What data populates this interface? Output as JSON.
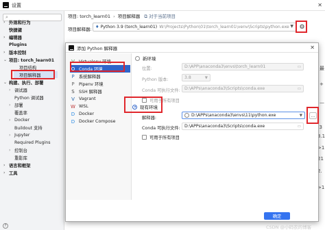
{
  "window": {
    "title": "设置"
  },
  "sidebar": {
    "items": [
      {
        "label": "外观和行为",
        "chev": "›",
        "bold": true
      },
      {
        "label": "快捷键",
        "chev": "",
        "bold": true
      },
      {
        "label": "编辑器",
        "chev": "›",
        "bold": true
      },
      {
        "label": "Plugins",
        "chev": "",
        "bold": true
      },
      {
        "label": "版本控制",
        "chev": "›",
        "bold": true
      },
      {
        "label": "项目: torch_learn01",
        "chev": "⌄",
        "bold": true
      },
      {
        "label": "项目结构",
        "chev": "",
        "bold": false
      },
      {
        "label": "项目解释器",
        "chev": "",
        "bold": false
      },
      {
        "label": "构建、执行、部署",
        "chev": "⌄",
        "bold": true
      },
      {
        "label": "调试器",
        "chev": "›",
        "bold": false
      },
      {
        "label": "Python 调试器",
        "chev": "",
        "bold": false
      },
      {
        "label": "部署",
        "chev": "›",
        "bold": false
      },
      {
        "label": "覆盖率",
        "chev": "",
        "bold": false
      },
      {
        "label": "Docker",
        "chev": "›",
        "bold": false
      },
      {
        "label": "Buildout 支持",
        "chev": "",
        "bold": false
      },
      {
        "label": "Jupyter",
        "chev": "›",
        "bold": false
      },
      {
        "label": "Required Plugins",
        "chev": "",
        "bold": false
      },
      {
        "label": "控制台",
        "chev": "›",
        "bold": false
      },
      {
        "label": "重影库",
        "chev": "",
        "bold": false
      },
      {
        "label": "语言和框架",
        "chev": "›",
        "bold": true
      },
      {
        "label": "工具",
        "chev": "›",
        "bold": true
      }
    ]
  },
  "breadcrumb": {
    "project": "项目: torch_learn01",
    "sep": "›",
    "page": "项目解释器",
    "scope": "对于当前项目"
  },
  "interpreter": {
    "label": "项目解释器:",
    "value": "Python 3.9 (torch_learn01)",
    "path": "W:\\Projects\\Python\\01\\torch_learn01\\venv\\Scripts\\python.exe"
  },
  "background_fragments": [
    "最",
    "+",
    "—",
    "-3",
    "3.1",
    ">1",
    "21",
    "2.",
    ">1"
  ],
  "dialog": {
    "title": "添加 Python 解释器",
    "env_types": [
      {
        "label": "Virtualenv 环境",
        "icon": "V"
      },
      {
        "label": "Conda 环境",
        "icon": "O"
      },
      {
        "label": "系统解释器",
        "icon": "P"
      },
      {
        "label": "Pipenv 环境",
        "icon": "P"
      },
      {
        "label": "SSH 解释器",
        "icon": "S"
      },
      {
        "label": "Vagrant",
        "icon": "V"
      },
      {
        "label": "WSL",
        "icon": "W"
      },
      {
        "label": "Docker",
        "icon": "D"
      },
      {
        "label": "Docker Compose",
        "icon": "D"
      }
    ],
    "new_env": {
      "radio_label": "新环境",
      "location_label": "位置:",
      "location_value": "D:\\APP\\anaconda3\\envs\\torch_learn01",
      "python_version_label": "Python 版本:",
      "python_version_value": "3.8",
      "conda_exe_label": "Conda 可执行文件:",
      "conda_exe_value": "D:\\APPs\\anaconda3\\Scripts\\conda.exe",
      "share_label": "可用于所有项目"
    },
    "existing_env": {
      "radio_label": "现有环境",
      "interpreter_label": "解释器:",
      "interpreter_value": "D:\\APPs\\anaconda3\\envs\\11\\python.exe",
      "conda_exe_label": "Conda 可执行文件:",
      "conda_exe_value": "D:\\APPs\\anaconda3\\Scripts\\conda.exe",
      "share_label": "可用于所有项目"
    },
    "browse_label": "...",
    "ok_label": "确定"
  },
  "watermark": "CSDN @小码农的博客",
  "help_label": "?",
  "accent_colors": {
    "highlight": "#e0262b",
    "selection": "#2f65ca",
    "primary_button": "#3574f0"
  }
}
